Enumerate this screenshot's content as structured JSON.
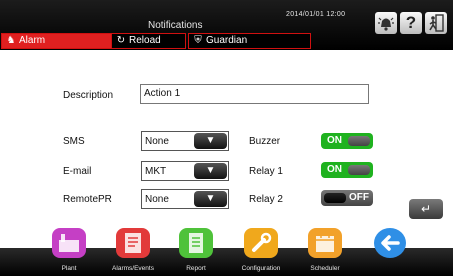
{
  "header": {
    "title": "Notifications",
    "datetime": "2014/01/01  12:00",
    "icons": [
      "alarm-bell-icon",
      "help-icon",
      "exit-icon"
    ]
  },
  "tabs": [
    {
      "label": "Alarm",
      "icon": "alarm-icon",
      "active": true
    },
    {
      "label": "Reload",
      "icon": "reload-icon",
      "active": false
    },
    {
      "label": "Guardian",
      "icon": "shield-icon",
      "active": false
    }
  ],
  "form": {
    "description_label": "Description",
    "description_value": "Action 1",
    "sms": {
      "label": "SMS",
      "value": "None"
    },
    "email": {
      "label": "E-mail",
      "value": "MKT"
    },
    "remotepr": {
      "label": "RemotePR",
      "value": "None"
    },
    "buzzer": {
      "label": "Buzzer",
      "state": "ON"
    },
    "relay1": {
      "label": "Relay 1",
      "state": "ON"
    },
    "relay2": {
      "label": "Relay 2",
      "state": "OFF"
    }
  },
  "enter_button": {
    "icon": "enter-icon"
  },
  "colors": {
    "accent": "#e02020",
    "toggle_on": "#1fb21f"
  },
  "bottom_nav": [
    {
      "label": "Plant",
      "icon": "plant-icon",
      "color": "#c53fc5"
    },
    {
      "label": "Alarms/Events",
      "icon": "alarms-events-icon",
      "color": "#e23a3a"
    },
    {
      "label": "Report",
      "icon": "report-icon",
      "color": "#4fc23a"
    },
    {
      "label": "Configuration",
      "icon": "configuration-icon",
      "color": "#f0a81c"
    },
    {
      "label": "Scheduler",
      "icon": "scheduler-icon",
      "color": "#f2a12a"
    },
    {
      "label": "",
      "icon": "back-arrow-icon",
      "color": "#2f8fe6"
    }
  ]
}
